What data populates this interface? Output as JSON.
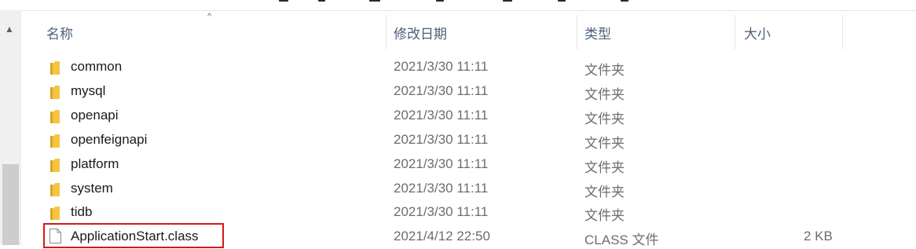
{
  "header": {
    "col_name": "名称",
    "col_date": "修改日期",
    "col_type": "类型",
    "col_size": "大小",
    "sort_indicator": "^"
  },
  "rows": [
    {
      "name": "common",
      "date": "2021/3/30 11:11",
      "type": "文件夹",
      "size": "",
      "icon": "folder-icon"
    },
    {
      "name": "mysql",
      "date": "2021/3/30 11:11",
      "type": "文件夹",
      "size": "",
      "icon": "folder-icon"
    },
    {
      "name": "openapi",
      "date": "2021/3/30 11:11",
      "type": "文件夹",
      "size": "",
      "icon": "folder-icon"
    },
    {
      "name": "openfeignapi",
      "date": "2021/3/30 11:11",
      "type": "文件夹",
      "size": "",
      "icon": "folder-icon"
    },
    {
      "name": "platform",
      "date": "2021/3/30 11:11",
      "type": "文件夹",
      "size": "",
      "icon": "folder-icon"
    },
    {
      "name": "system",
      "date": "2021/3/30 11:11",
      "type": "文件夹",
      "size": "",
      "icon": "folder-icon"
    },
    {
      "name": "tidb",
      "date": "2021/3/30 11:11",
      "type": "文件夹",
      "size": "",
      "icon": "folder-icon"
    },
    {
      "name": "ApplicationStart.class",
      "date": "2021/4/12 22:50",
      "type": "CLASS 文件",
      "size": "2 KB",
      "icon": "file-icon"
    }
  ],
  "colors": {
    "header_text": "#4c607a",
    "highlight_border": "#d41919",
    "folder": "#f5c542"
  }
}
